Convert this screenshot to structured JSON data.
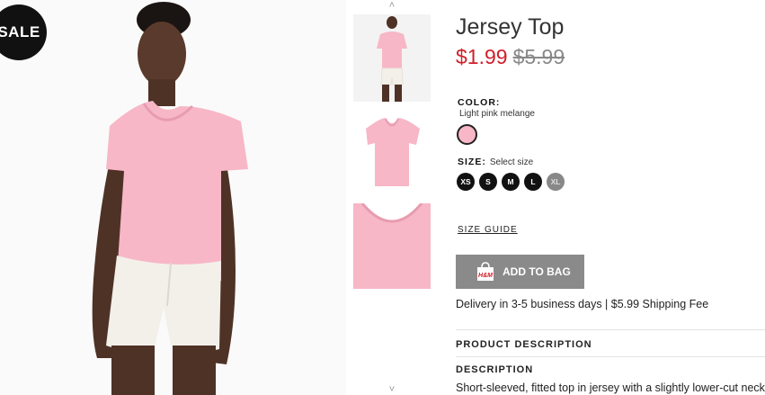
{
  "badge": {
    "label": "SALE"
  },
  "product": {
    "title": "Jersey Top",
    "price_now": "$1.99",
    "price_was": "$5.99"
  },
  "color": {
    "label": "COLOR:",
    "selected": "Light pink melange",
    "swatch_hex": "#f7b7c7"
  },
  "size": {
    "label": "SIZE:",
    "hint": "Select size",
    "options": [
      "XS",
      "S",
      "M",
      "L",
      "XL"
    ],
    "unavailable": [
      "XL"
    ]
  },
  "size_guide": "SIZE GUIDE",
  "add_to_bag": {
    "label": "ADD TO BAG",
    "brand_mark": "H&M"
  },
  "delivery": "Delivery in 3-5 business days | $5.99 Shipping Fee",
  "product_description": {
    "heading": "PRODUCT DESCRIPTION"
  },
  "description": {
    "heading": "DESCRIPTION",
    "text": "Short-sleeved, fitted top in jersey with a slightly lower-cut neckline"
  },
  "thumbnails": {
    "up_arrow": "˄",
    "down_arrow": "˅"
  },
  "colors": {
    "sale_price": "#d0202a",
    "button_bg": "#8a8a8a",
    "shirt_pink": "#f7b7c7",
    "shorts_cream": "#f3f0ea"
  }
}
